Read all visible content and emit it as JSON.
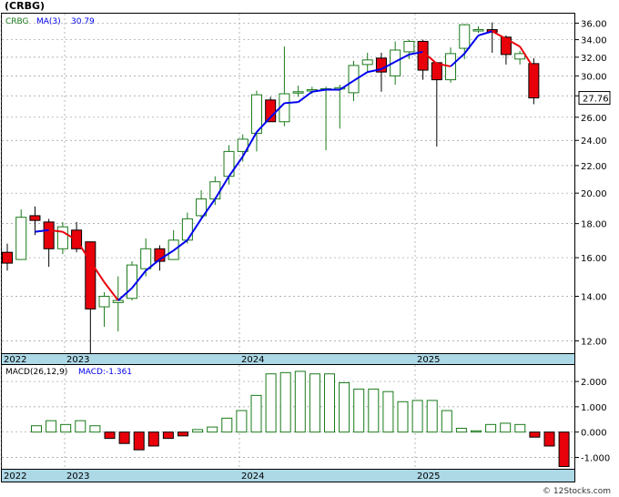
{
  "title": "(CRBG)",
  "colors": {
    "up": "#1a7a1a",
    "down": "#e8000b",
    "ma_up": "#0000ee",
    "ma_down": "#e8000b",
    "axis_band": "#add8e6",
    "grid": "#888888",
    "macd": "#1a7a1a"
  },
  "price_panel": {
    "ticker_label": "CRBG",
    "ma_label": "MA(3)",
    "ma_value": "30.79",
    "last_price": "27.76",
    "y_ticks": [
      "36.00",
      "34.00",
      "32.00",
      "30.00",
      "28.00",
      "26.00",
      "24.00",
      "22.00",
      "20.00",
      "18.00",
      "16.00",
      "14.00",
      "12.00"
    ]
  },
  "macd_panel": {
    "label": "MACD(26,12,9)",
    "value_label": "MACD:-1.361",
    "y_ticks": [
      "2.000",
      "1.000",
      "0.000",
      "-1.000"
    ]
  },
  "x_axis_labels": [
    "2022",
    "2023",
    "2024",
    "2025"
  ],
  "watermark": "© 12Stocks.com",
  "chart_data": {
    "type": "candlestick",
    "scale": "log",
    "ylim": [
      11.5,
      37.2
    ],
    "candles": [
      {
        "o": 16.3,
        "h": 16.8,
        "l": 15.3,
        "c": 15.7,
        "ma": null
      },
      {
        "o": 15.9,
        "h": 18.9,
        "l": 15.9,
        "c": 18.4,
        "ma": null
      },
      {
        "o": 18.5,
        "h": 19.1,
        "l": 17.3,
        "c": 18.2,
        "ma": 17.5
      },
      {
        "o": 18.1,
        "h": 18.3,
        "l": 15.5,
        "c": 16.5,
        "ma": 17.6
      },
      {
        "o": 16.5,
        "h": 18.1,
        "l": 16.2,
        "c": 17.8,
        "ma": 17.5
      },
      {
        "o": 17.6,
        "h": 18.1,
        "l": 16.3,
        "c": 16.5,
        "ma": 17.0
      },
      {
        "o": 16.9,
        "h": 16.9,
        "l": 11.5,
        "c": 13.4,
        "ma": 15.8
      },
      {
        "o": 13.5,
        "h": 14.2,
        "l": 12.6,
        "c": 14.0,
        "ma": 14.7
      },
      {
        "o": 13.7,
        "h": 15.0,
        "l": 12.4,
        "c": 13.8,
        "ma": 13.8
      },
      {
        "o": 13.9,
        "h": 15.8,
        "l": 13.8,
        "c": 15.6,
        "ma": 14.4
      },
      {
        "o": 15.4,
        "h": 17.1,
        "l": 15.0,
        "c": 16.5,
        "ma": 15.3
      },
      {
        "o": 16.5,
        "h": 16.7,
        "l": 15.3,
        "c": 15.8,
        "ma": 15.9
      },
      {
        "o": 15.9,
        "h": 17.6,
        "l": 15.9,
        "c": 17.0,
        "ma": 16.4
      },
      {
        "o": 17.0,
        "h": 18.7,
        "l": 16.8,
        "c": 18.3,
        "ma": 17.0
      },
      {
        "o": 18.5,
        "h": 20.2,
        "l": 18.3,
        "c": 19.6,
        "ma": 18.3
      },
      {
        "o": 19.6,
        "h": 21.2,
        "l": 19.2,
        "c": 20.8,
        "ma": 19.6
      },
      {
        "o": 21.2,
        "h": 23.6,
        "l": 20.6,
        "c": 23.1,
        "ma": 21.2
      },
      {
        "o": 23.1,
        "h": 24.5,
        "l": 22.3,
        "c": 24.1,
        "ma": 22.7
      },
      {
        "o": 24.6,
        "h": 28.5,
        "l": 23.1,
        "c": 28.1,
        "ma": 24.7
      },
      {
        "o": 27.6,
        "h": 27.9,
        "l": 25.6,
        "c": 25.6,
        "ma": 26.0
      },
      {
        "o": 25.6,
        "h": 33.2,
        "l": 25.2,
        "c": 28.2,
        "ma": 27.3
      },
      {
        "o": 28.4,
        "h": 29.0,
        "l": 27.9,
        "c": 28.4,
        "ma": 27.4
      },
      {
        "o": 28.6,
        "h": 28.9,
        "l": 28.2,
        "c": 28.6,
        "ma": 28.4
      },
      {
        "o": 28.6,
        "h": 28.9,
        "l": 23.2,
        "c": 28.7,
        "ma": 28.6
      },
      {
        "o": 28.8,
        "h": 29.1,
        "l": 25.0,
        "c": 28.8,
        "ma": 28.6
      },
      {
        "o": 28.3,
        "h": 31.6,
        "l": 27.5,
        "c": 31.1,
        "ma": 29.5
      },
      {
        "o": 31.2,
        "h": 32.5,
        "l": 30.3,
        "c": 31.7,
        "ma": 30.4
      },
      {
        "o": 31.9,
        "h": 32.5,
        "l": 28.4,
        "c": 30.4,
        "ma": 30.7
      },
      {
        "o": 30.0,
        "h": 33.8,
        "l": 29.1,
        "c": 32.8,
        "ma": 31.5
      },
      {
        "o": 32.6,
        "h": 34.0,
        "l": 31.8,
        "c": 33.8,
        "ma": 32.3
      },
      {
        "o": 33.8,
        "h": 34.0,
        "l": 29.6,
        "c": 30.6,
        "ma": 32.6
      },
      {
        "o": 31.4,
        "h": 31.4,
        "l": 23.5,
        "c": 29.6,
        "ma": 31.3
      },
      {
        "o": 29.6,
        "h": 33.1,
        "l": 29.3,
        "c": 32.4,
        "ma": 31.0
      },
      {
        "o": 33.0,
        "h": 35.9,
        "l": 31.8,
        "c": 35.8,
        "ma": 32.4
      },
      {
        "o": 35.2,
        "h": 35.6,
        "l": 34.8,
        "c": 35.2,
        "ma": 34.5
      },
      {
        "o": 35.2,
        "h": 36.1,
        "l": 32.5,
        "c": 34.9,
        "ma": 35.0
      },
      {
        "o": 34.3,
        "h": 34.5,
        "l": 31.2,
        "c": 32.3,
        "ma": 34.1
      },
      {
        "o": 31.8,
        "h": 32.7,
        "l": 31.2,
        "c": 32.4,
        "ma": 33.2
      },
      {
        "o": 31.3,
        "h": 31.9,
        "l": 27.2,
        "c": 27.8,
        "ma": 30.8
      }
    ],
    "macd_hist": [
      0.25,
      0.45,
      0.3,
      0.45,
      0.25,
      -0.25,
      -0.45,
      -0.7,
      -0.55,
      -0.25,
      -0.15,
      0.1,
      0.2,
      0.55,
      0.85,
      1.45,
      2.3,
      2.35,
      2.4,
      2.3,
      2.3,
      1.95,
      1.7,
      1.7,
      1.6,
      1.2,
      1.25,
      1.25,
      0.85,
      0.15,
      0.05,
      0.3,
      0.35,
      0.3,
      -0.2,
      -0.55,
      -1.36
    ]
  }
}
